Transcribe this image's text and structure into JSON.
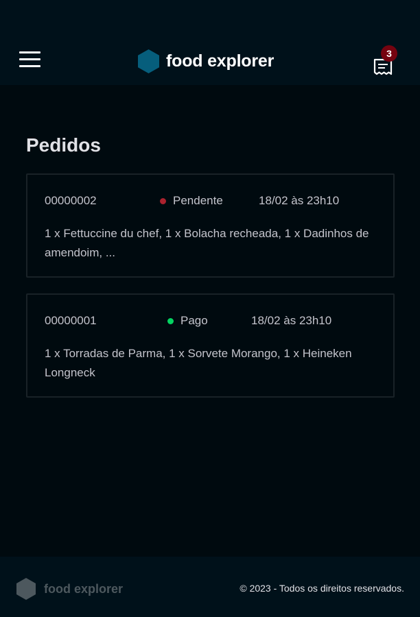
{
  "header": {
    "brand": "food explorer",
    "receipt_count": "3"
  },
  "main": {
    "title": "Pedidos",
    "orders": [
      {
        "id": "00000002",
        "status": "Pendente",
        "status_color": "#ab222e",
        "date": "18/02 às 23h10",
        "items": "1 x Fettuccine du chef, 1 x Bolacha recheada, 1 x Dadinhos de amendoim, ..."
      },
      {
        "id": "00000001",
        "status": "Pago",
        "status_color": "#04d361",
        "date": "18/02 às 23h10",
        "items": "1 x Torradas de Parma, 1 x Sorvete Morango, 1 x Heineken Longneck"
      }
    ]
  },
  "footer": {
    "brand": "food explorer",
    "copyright": "© 2023 - Todos os direitos reservados."
  },
  "colors": {
    "background": "#000a0f",
    "header_bg": "#00111a",
    "brand_hexagon": "#065e7c",
    "badge": "#750310",
    "card_border": "#192227"
  },
  "icons": {
    "menu": "hamburger-menu-icon",
    "logo": "hexagon-logo-icon",
    "receipt": "receipt-icon"
  }
}
